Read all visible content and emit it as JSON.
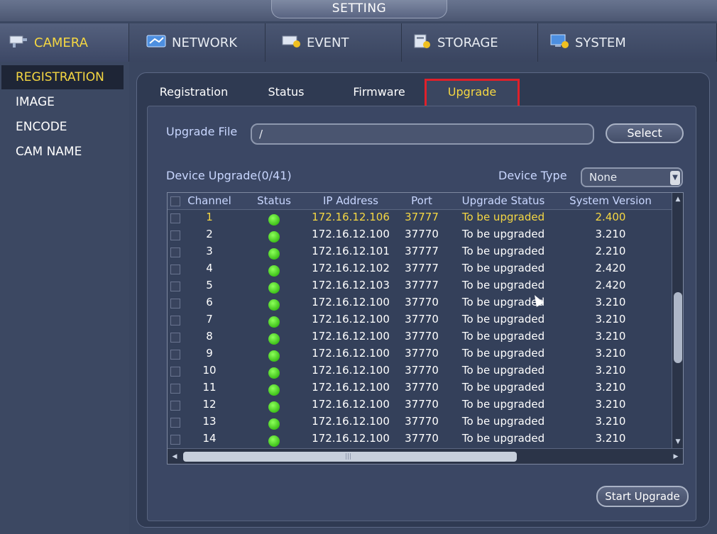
{
  "window": {
    "title": "SETTING"
  },
  "top_nav": [
    {
      "label": "CAMERA",
      "icon": "camera-icon",
      "active": true
    },
    {
      "label": "NETWORK",
      "icon": "network-icon",
      "active": false
    },
    {
      "label": "EVENT",
      "icon": "event-icon",
      "active": false
    },
    {
      "label": "STORAGE",
      "icon": "storage-icon",
      "active": false
    },
    {
      "label": "SYSTEM",
      "icon": "system-icon",
      "active": false
    }
  ],
  "sidebar": {
    "items": [
      {
        "label": "REGISTRATION",
        "active": true
      },
      {
        "label": "IMAGE",
        "active": false
      },
      {
        "label": "ENCODE",
        "active": false
      },
      {
        "label": "CAM NAME",
        "active": false
      }
    ]
  },
  "tabs": [
    {
      "label": "Registration",
      "active": false
    },
    {
      "label": "Status",
      "active": false
    },
    {
      "label": "Firmware",
      "active": false
    },
    {
      "label": "Upgrade",
      "active": true
    }
  ],
  "upgrade": {
    "file_label": "Upgrade File",
    "file_value": "/",
    "select_label": "Select",
    "device_upgrade_label": "Device Upgrade(0/41)",
    "device_type_label": "Device Type",
    "device_type_value": "None",
    "start_label": "Start Upgrade"
  },
  "table": {
    "columns": [
      "Channel",
      "Status",
      "IP Address",
      "Port",
      "Upgrade Status",
      "System Version"
    ],
    "rows": [
      {
        "channel": "1",
        "ip": "172.16.12.106",
        "port": "37777",
        "status": "To be upgraded",
        "version": "2.400",
        "highlight": true
      },
      {
        "channel": "2",
        "ip": "172.16.12.100",
        "port": "37770",
        "status": "To be upgraded",
        "version": "3.210",
        "highlight": false
      },
      {
        "channel": "3",
        "ip": "172.16.12.101",
        "port": "37777",
        "status": "To be upgraded",
        "version": "2.210",
        "highlight": false
      },
      {
        "channel": "4",
        "ip": "172.16.12.102",
        "port": "37777",
        "status": "To be upgraded",
        "version": "2.420",
        "highlight": false
      },
      {
        "channel": "5",
        "ip": "172.16.12.103",
        "port": "37777",
        "status": "To be upgraded",
        "version": "2.420",
        "highlight": false
      },
      {
        "channel": "6",
        "ip": "172.16.12.100",
        "port": "37770",
        "status": "To be upgraded",
        "version": "3.210",
        "highlight": false
      },
      {
        "channel": "7",
        "ip": "172.16.12.100",
        "port": "37770",
        "status": "To be upgraded",
        "version": "3.210",
        "highlight": false
      },
      {
        "channel": "8",
        "ip": "172.16.12.100",
        "port": "37770",
        "status": "To be upgraded",
        "version": "3.210",
        "highlight": false
      },
      {
        "channel": "9",
        "ip": "172.16.12.100",
        "port": "37770",
        "status": "To be upgraded",
        "version": "3.210",
        "highlight": false
      },
      {
        "channel": "10",
        "ip": "172.16.12.100",
        "port": "37770",
        "status": "To be upgraded",
        "version": "3.210",
        "highlight": false
      },
      {
        "channel": "11",
        "ip": "172.16.12.100",
        "port": "37770",
        "status": "To be upgraded",
        "version": "3.210",
        "highlight": false
      },
      {
        "channel": "12",
        "ip": "172.16.12.100",
        "port": "37770",
        "status": "To be upgraded",
        "version": "3.210",
        "highlight": false
      },
      {
        "channel": "13",
        "ip": "172.16.12.100",
        "port": "37770",
        "status": "To be upgraded",
        "version": "3.210",
        "highlight": false
      },
      {
        "channel": "14",
        "ip": "172.16.12.100",
        "port": "37770",
        "status": "To be upgraded",
        "version": "3.210",
        "highlight": false
      }
    ]
  },
  "colors": {
    "accent_yellow": "#f5d742",
    "highlight_box": "#e0202a",
    "status_ok": "#3fc21a"
  }
}
